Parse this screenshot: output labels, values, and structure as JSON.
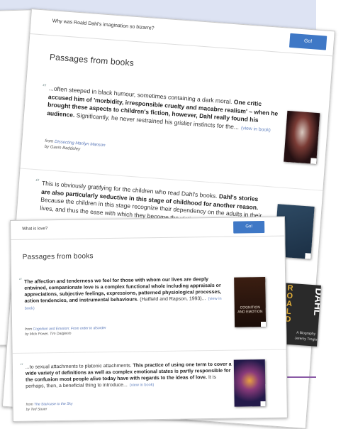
{
  "back_page": {
    "search_query": "Why was Roald Dahl's imagination so bizarre?",
    "go_label": "Go!",
    "heading": "Passages from books",
    "passages": [
      {
        "text_before": "...often steeped in black humour, sometimes containing a dark moral. ",
        "bold": "One critic accused him of 'morbidity, irresponsible cruelty and macabre realism' – when he brought these aspects to children's fiction, however, Dahl really found his audience.",
        "text_after": " Significantly, he never restrained his grislier instincts for the...",
        "link": "(view in book)",
        "from_prefix": "from ",
        "book_title": "Dissecting Marilyn Manson",
        "author_line": "by Gavin Baddeley"
      },
      {
        "text_before": "This is obviously gratifying for the children who read Dahl's books. ",
        "bold": "Dahl's stories are also particularly seductive in this stage of childhood for another reason.",
        "text_after": " Because the children in this stage recognize their dependency on the adults in their lives, and thus the ease with which they become the victims of",
        "link": "",
        "from_prefix": "",
        "book_title": "",
        "author_line": ""
      }
    ]
  },
  "front_page": {
    "search_query": "What is love?",
    "go_label": "Go!",
    "heading": "Passages from books",
    "passages": [
      {
        "text_before": "",
        "bold": "The affection and tenderness we feel for those with whom our lives are deeply entwined, companionate love is a complex functional whole including appraisals or appreciations, subjective feelings, expressions, patterned physiological processes, action tendencies, and instrumental behaviours.",
        "text_after": " (Hatfield and Rapson, 1993)...",
        "link": "(view in book)",
        "from_prefix": "from ",
        "book_title": "Cognition and Emotion: From order to disorder",
        "author_line": "by Mick Power, Tim Dalgleish",
        "cover_title": "COGNITION AND EMOTION"
      },
      {
        "text_before": "...to sexual attachments to platonic attachments. ",
        "bold": "This practice of using one term to cover a wide variety of definitions as well as complex emotional states is partly responsible for the confusion most people alive today have with regards to the ideas of love.",
        "text_after": " It is perhaps, then, a beneficial thing to introduce...",
        "link": "(view in book)",
        "from_prefix": "from ",
        "book_title": "The Staircase to the Sky",
        "author_line": "by Ted Sauer",
        "cover_title": ""
      }
    ]
  },
  "roald_cover": {
    "letters": [
      "R",
      "O",
      "A",
      "L",
      "D"
    ],
    "word": "DAHL",
    "subtitle": "A Biography",
    "author": "Jeremy Treglown"
  },
  "colors": {
    "go_button": "#3f78c6",
    "link": "#6a88c2",
    "background_band": "#dde3f3"
  }
}
